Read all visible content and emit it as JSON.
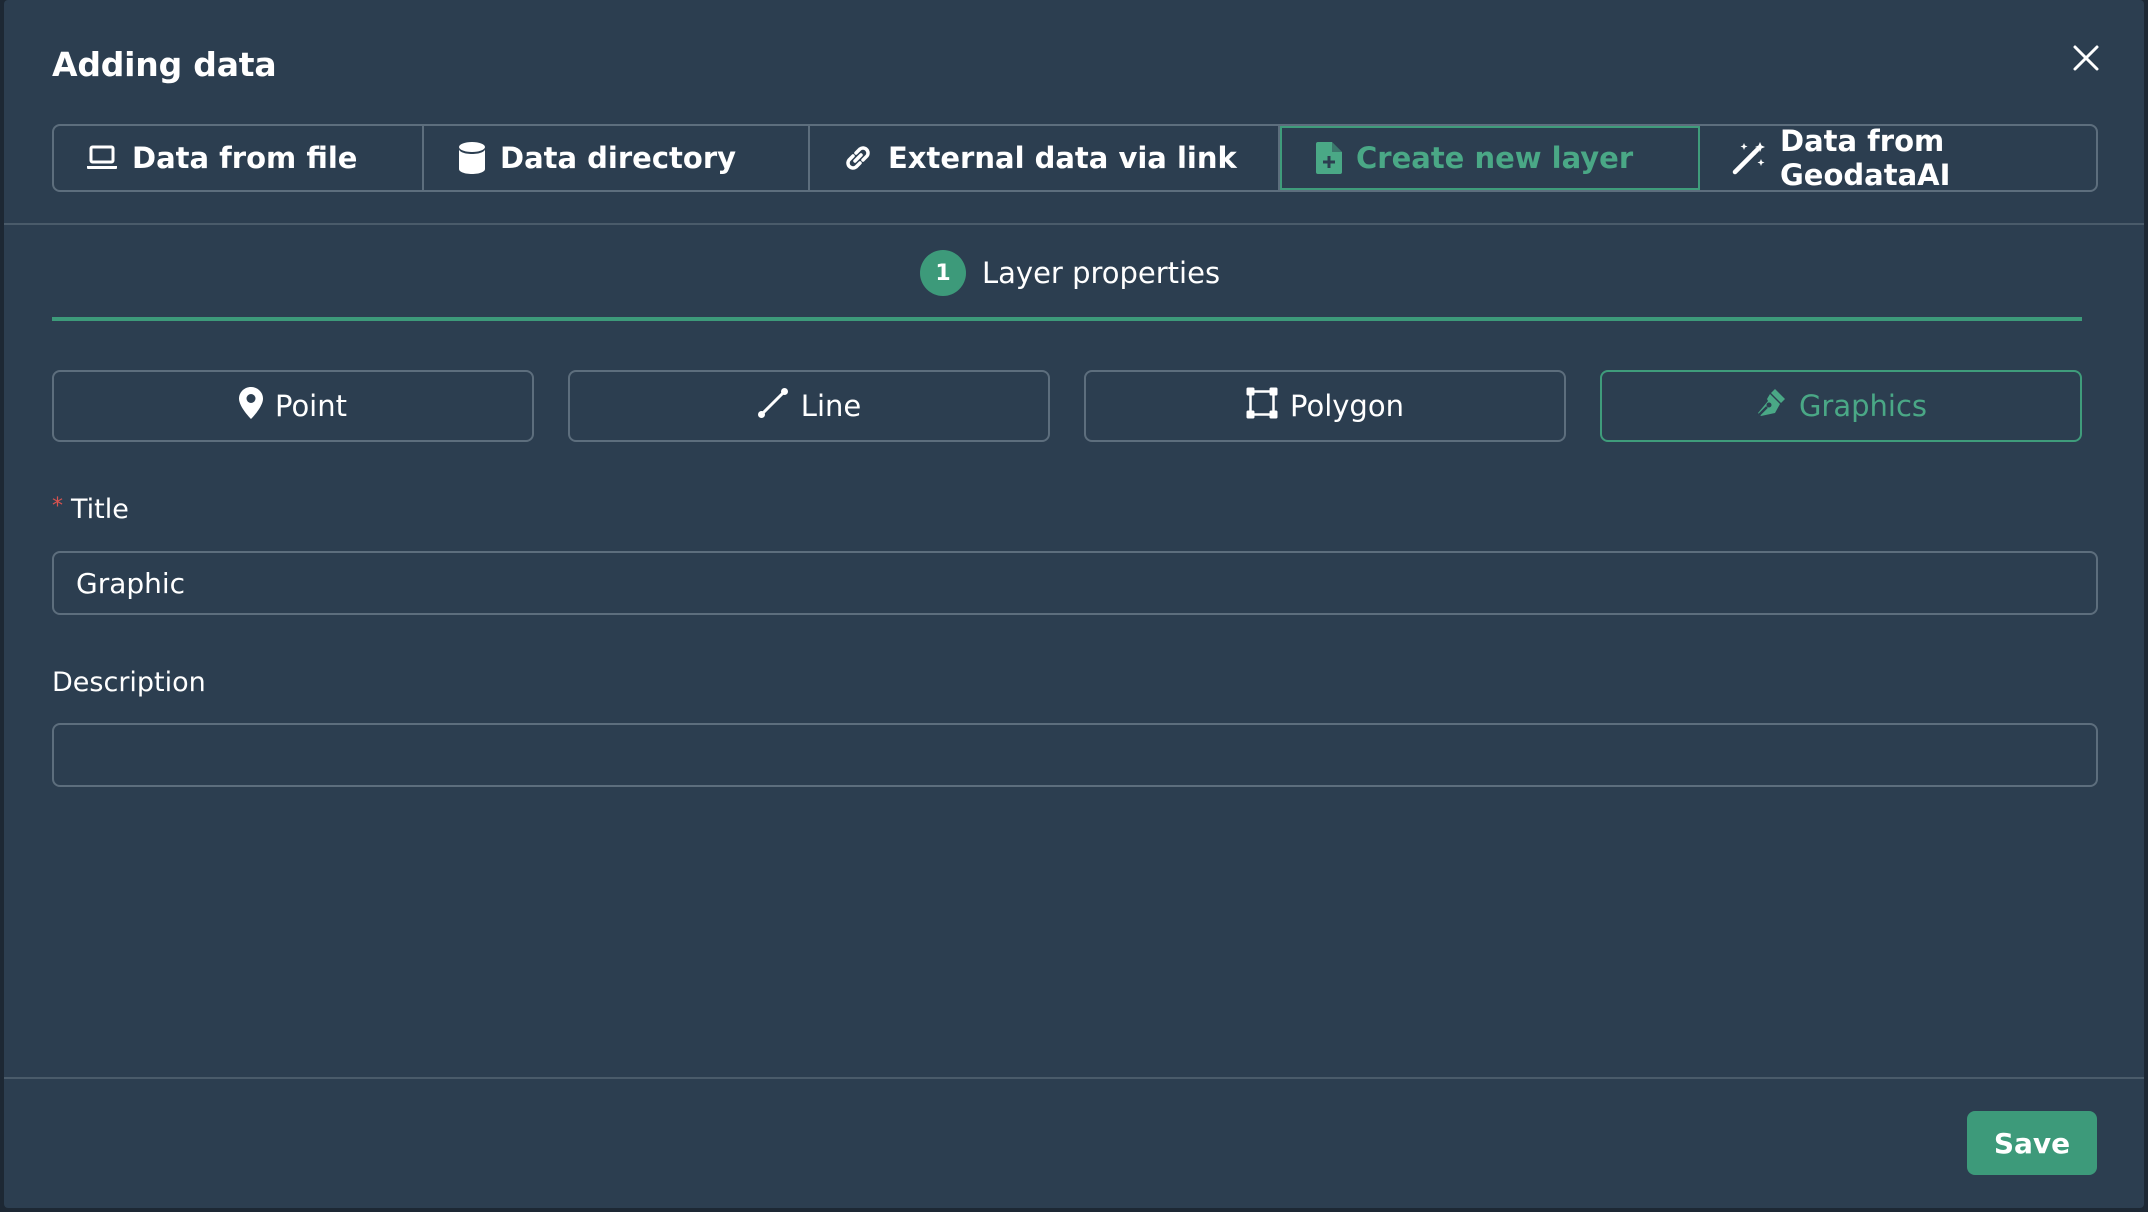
{
  "dialog": {
    "title": "Adding data"
  },
  "tabs": [
    {
      "label": "Data from file",
      "icon": "laptop-icon"
    },
    {
      "label": "Data directory",
      "icon": "database-icon"
    },
    {
      "label": "External data via link",
      "icon": "link-icon"
    },
    {
      "label": "Create new layer",
      "icon": "file-plus-icon",
      "active": true
    },
    {
      "label": "Data from GeodataAI",
      "icon": "magic-wand-icon"
    }
  ],
  "step": {
    "number": "1",
    "label": "Layer properties"
  },
  "geometry_types": [
    {
      "label": "Point",
      "icon": "map-pin-icon"
    },
    {
      "label": "Line",
      "icon": "line-icon"
    },
    {
      "label": "Polygon",
      "icon": "polygon-icon"
    },
    {
      "label": "Graphics",
      "icon": "pen-nib-icon",
      "active": true
    }
  ],
  "form": {
    "title_required_mark": "*",
    "title_label": "Title",
    "title_value": "Graphic",
    "description_label": "Description",
    "description_value": ""
  },
  "footer": {
    "save_label": "Save"
  },
  "colors": {
    "accent": "#3d9a7a",
    "dialog_bg": "#2c3e50",
    "border": "#5d6e7d"
  }
}
